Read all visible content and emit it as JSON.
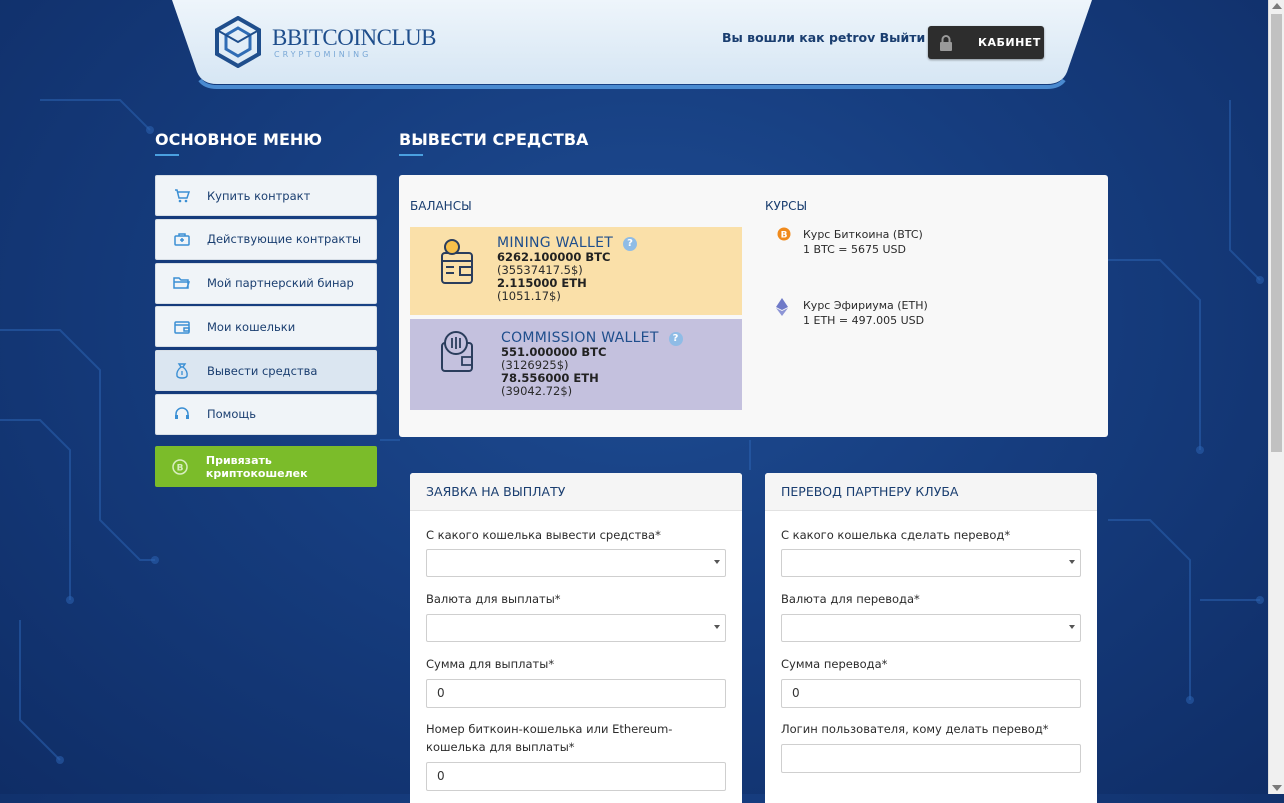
{
  "header": {
    "logo_name": "BBITCOINCLUB",
    "logo_sub": "CRYPTOMINING",
    "logged_prefix": "Вы вошли как",
    "username": "petrov",
    "logout": "Выйти",
    "cabinet": "КАБИНЕТ"
  },
  "sidebar": {
    "title": "ОСНОВНОЕ МЕНЮ",
    "items": [
      {
        "label": "Купить контракт",
        "icon": "cart-icon"
      },
      {
        "label": "Действующие контракты",
        "icon": "briefcase-icon"
      },
      {
        "label": "Мой партнерский бинар",
        "icon": "folder-icon"
      },
      {
        "label": "Мои кошельки",
        "icon": "wallet-icon"
      },
      {
        "label": "Вывести средства",
        "icon": "moneybag-icon",
        "active": true
      },
      {
        "label": "Помощь",
        "icon": "headset-icon"
      }
    ],
    "bind_wallet": {
      "label": "Привязать криптокошелек",
      "icon": "bitcoin-icon"
    }
  },
  "main": {
    "title": "ВЫВЕСТИ СРЕДСТВА",
    "balances": {
      "label": "БАЛАНСЫ",
      "mining": {
        "title": "MINING WALLET",
        "btc": "6262.100000 BTC",
        "btc_usd": "(35537417.5$)",
        "eth": "2.115000 ETH",
        "eth_usd": "(1051.17$)"
      },
      "commission": {
        "title": "COMMISSION WALLET",
        "btc": "551.000000 BTC",
        "btc_usd": "(3126925$)",
        "eth": "78.556000 ETH",
        "eth_usd": "(39042.72$)"
      },
      "help_glyph": "?"
    },
    "rates": {
      "label": "КУРСЫ",
      "btc": {
        "name": "Курс Биткоина (BTC)",
        "value": "1 BTC = 5675 USD"
      },
      "eth": {
        "name": "Курс Эфириума (ETH)",
        "value": "1 ETH = 497.005 USD"
      }
    },
    "payout_form": {
      "title": "ЗАЯВКА НА ВЫПЛАТУ",
      "wallet_label": "С какого кошелька вывести средства*",
      "currency_label": "Валюта для выплаты*",
      "amount_label": "Сумма для выплаты*",
      "amount_value": "0",
      "address_label": "Номер биткоин-кошелька или Ethereum-кошелька для выплаты*",
      "address_value": "0"
    },
    "transfer_form": {
      "title": "ПЕРЕВОД ПАРТНЕРУ КЛУБА",
      "wallet_label": "С какого кошелька сделать перевод*",
      "currency_label": "Валюта для перевода*",
      "amount_label": "Сумма перевода*",
      "amount_value": "0",
      "login_label": "Логин пользователя, кому делать перевод*",
      "login_value": ""
    }
  },
  "colors": {
    "background": "#163d7f",
    "menu_green": "#7bbc2a",
    "mining_wallet": "#fae0a9",
    "commission_wallet": "#c4c1de",
    "accent_text": "#1a3e70"
  }
}
